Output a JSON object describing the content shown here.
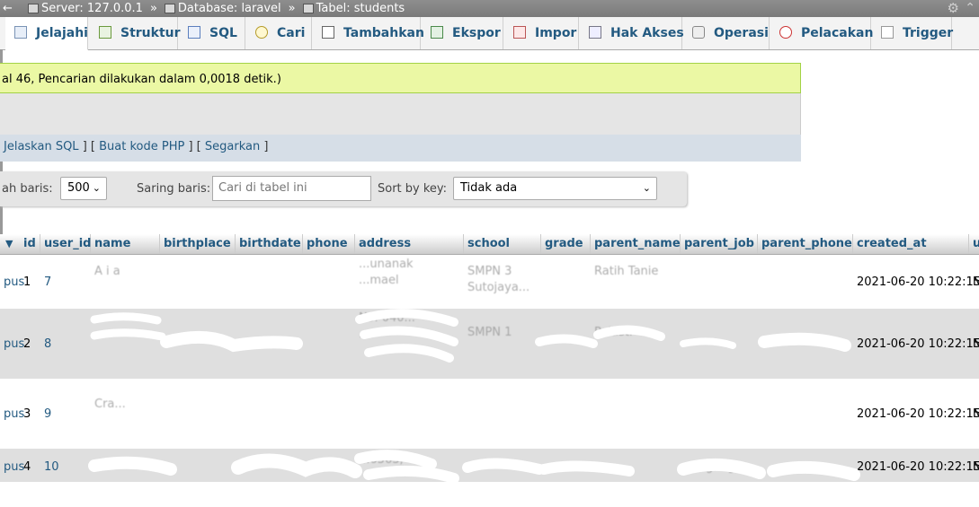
{
  "breadcrumb": {
    "back": "←",
    "server": "Server: 127.0.0.1",
    "database": "Database: laravel",
    "table": "Tabel: students",
    "separator": "»"
  },
  "tabs": [
    {
      "label": "Jelajahi",
      "icon": "browse-icon",
      "active": true
    },
    {
      "label": "Struktur",
      "icon": "structure-icon"
    },
    {
      "label": "SQL",
      "icon": "sql-icon"
    },
    {
      "label": "Cari",
      "icon": "search-icon"
    },
    {
      "label": "Tambahkan",
      "icon": "insert-icon"
    },
    {
      "label": "Ekspor",
      "icon": "export-icon"
    },
    {
      "label": "Impor",
      "icon": "import-icon"
    },
    {
      "label": "Hak Akses",
      "icon": "privileges-icon"
    },
    {
      "label": "Operasi",
      "icon": "operations-icon"
    },
    {
      "label": "Pelacakan",
      "icon": "tracking-icon"
    },
    {
      "label": "Trigger",
      "icon": "triggers-icon"
    }
  ],
  "message": "al 46, Pencarian dilakukan dalam 0,0018 detik.)",
  "sql_links": {
    "explain": "Jelaskan SQL",
    "php": "Buat kode PHP",
    "refresh": "Segarkan"
  },
  "filter": {
    "rows_label": "ah baris:",
    "rows_value": "500",
    "filter_label": "Saring baris:",
    "filter_placeholder": "Cari di tabel ini",
    "sort_label": "Sort by key:",
    "sort_value": "Tidak ada"
  },
  "columns": [
    "id",
    "user_id",
    "name",
    "birthplace",
    "birthdate",
    "phone",
    "address",
    "school",
    "grade",
    "parent_name",
    "parent_job",
    "parent_phone",
    "created_at",
    "u"
  ],
  "rows": [
    {
      "action": "pus",
      "id": "1",
      "user_id": "7",
      "name": [
        "",
        "A i a"
      ],
      "school": [
        "SMPN 3",
        "Sutojaya..."
      ],
      "address": [
        "",
        "...unanak",
        "...mael"
      ],
      "parent_name": [
        "Ratih Tanie",
        ""
      ],
      "parent_job": "",
      "parent_phone": "",
      "created_at": "2021-06-20 10:22:15",
      "u": "N"
    },
    {
      "action": "pus",
      "id": "2",
      "user_id": "8",
      "name": [
        "",
        ""
      ],
      "school": [
        "SMPN 1",
        ""
      ],
      "address": [
        "",
        "No. 040...",
        "..."
      ],
      "parent_name": [
        "",
        "Palusti"
      ],
      "parent_job": "",
      "parent_phone": "",
      "created_at": "2021-06-20 10:22:15",
      "u": "N"
    },
    {
      "action": "pus",
      "id": "3",
      "user_id": "9",
      "name": [
        "Cra...",
        ""
      ],
      "school": [
        "",
        ""
      ],
      "address": [
        "",
        ""
      ],
      "parent_name": [
        "",
        ""
      ],
      "parent_job": "",
      "parent_phone": "",
      "created_at": "2021-06-20 10:22:15",
      "u": "N"
    },
    {
      "action": "pus",
      "id": "4",
      "user_id": "10",
      "name": [
        "",
        ""
      ],
      "school": [
        "",
        ""
      ],
      "address": [
        "",
        "...6363,"
      ],
      "parent_name": [
        "",
        ""
      ],
      "parent_job": "...lagang",
      "parent_phone": "",
      "created_at": "2021-06-20 10:22:15",
      "u": "N"
    }
  ]
}
